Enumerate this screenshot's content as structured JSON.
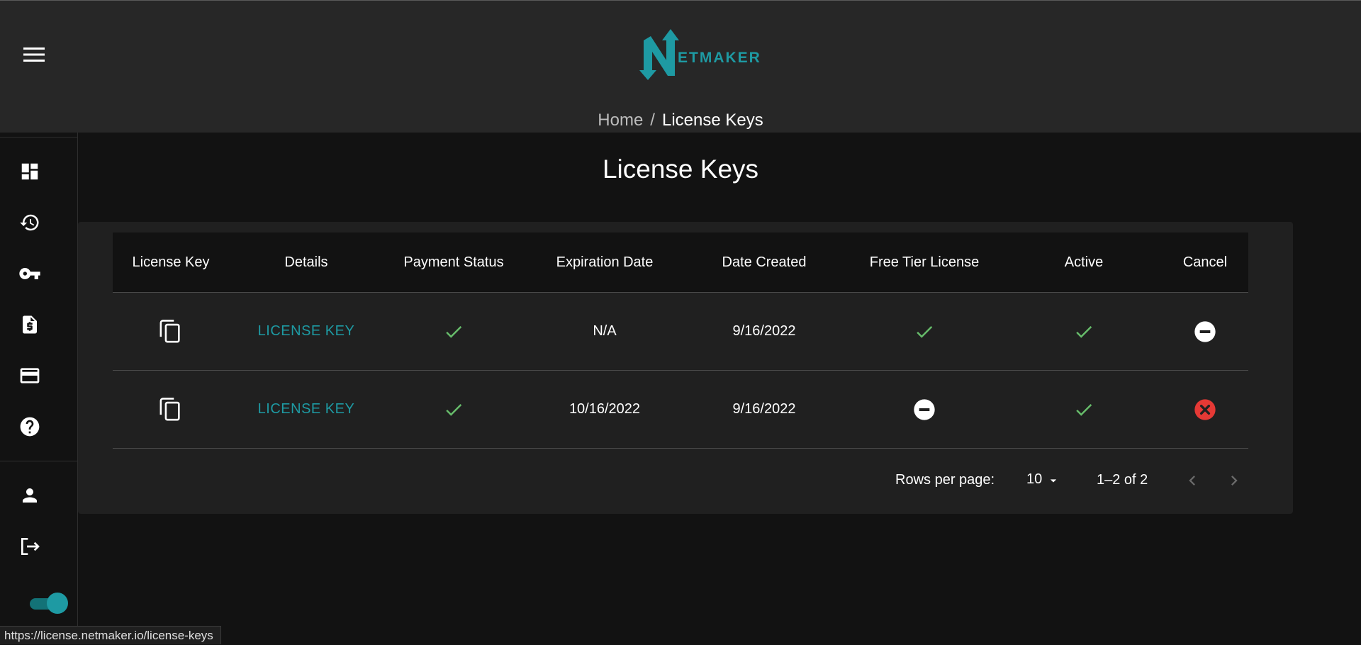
{
  "header": {
    "logo_text": "ETMAKER",
    "breadcrumb": {
      "home": "Home",
      "separator": "/",
      "current": "License Keys"
    }
  },
  "sidebar": {
    "items": [
      {
        "icon": "dashboard-icon"
      },
      {
        "icon": "history-icon"
      },
      {
        "icon": "key-icon"
      },
      {
        "icon": "invoice-icon"
      },
      {
        "icon": "credit-card-icon"
      },
      {
        "icon": "help-icon"
      },
      {
        "icon": "person-icon"
      },
      {
        "icon": "logout-icon"
      }
    ],
    "theme_toggle": {
      "on": true
    }
  },
  "page": {
    "title": "License Keys"
  },
  "table": {
    "columns": [
      "License Key",
      "Details",
      "Payment Status",
      "Expiration Date",
      "Date Created",
      "Free Tier License",
      "Active",
      "Cancel"
    ],
    "rows": [
      {
        "details": "LICENSE KEY",
        "payment_status": "check",
        "expiration": "N/A",
        "created": "9/16/2022",
        "free_tier": "check",
        "active": "check",
        "cancel": "remove-circle"
      },
      {
        "details": "LICENSE KEY",
        "payment_status": "check",
        "expiration": "10/16/2022",
        "created": "9/16/2022",
        "free_tier": "remove-circle",
        "active": "check",
        "cancel": "cancel-circle"
      }
    ]
  },
  "pagination": {
    "rows_per_page_label": "Rows per page:",
    "rows_per_page_value": "10",
    "range": "1–2 of 2"
  },
  "status_bar": {
    "url": "https://license.netmaker.io/license-keys"
  },
  "colors": {
    "accent": "#1e9aa3",
    "check": "#66bb6a",
    "error": "#e53935"
  }
}
